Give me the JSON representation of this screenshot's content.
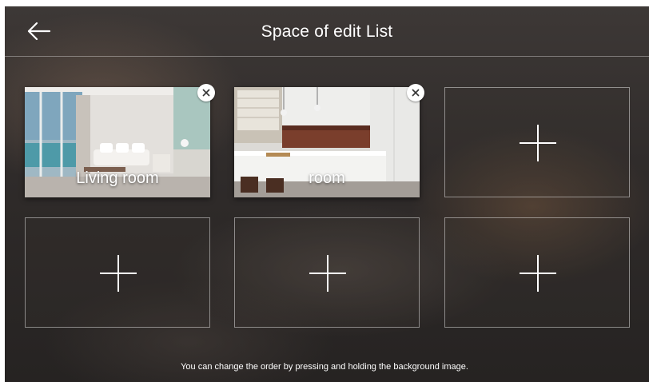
{
  "header": {
    "title": "Space of edit List",
    "back_icon": "arrow-left-icon"
  },
  "spaces": [
    {
      "label": "Living room",
      "image": "living-room-photo",
      "remove_icon": "close-icon"
    },
    {
      "label": "room",
      "image": "kitchen-photo",
      "remove_icon": "close-icon"
    }
  ],
  "add_tiles": {
    "icon": "plus-icon",
    "count": 4
  },
  "footer": {
    "hint": "You can change the order by pressing and holding the background image."
  },
  "colors": {
    "text": "#ffffff",
    "border": "#9a9593",
    "close_button_bg": "#ffffff"
  }
}
